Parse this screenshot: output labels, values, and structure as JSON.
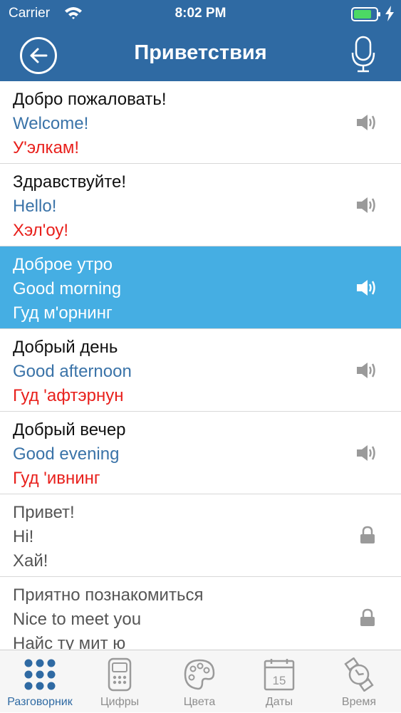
{
  "status_bar": {
    "carrier": "Carrier",
    "time": "8:02 PM"
  },
  "nav": {
    "title": "Приветствия"
  },
  "phrases": [
    {
      "native": "Добро пожаловать!",
      "english": "Welcome!",
      "transcription": "У'элкам!"
    },
    {
      "native": "Здравствуйте!",
      "english": "Hello!",
      "transcription": "Хэл'оу!"
    },
    {
      "native": "Доброе утро",
      "english": "Good morning",
      "transcription": "Гуд м'орнинг"
    },
    {
      "native": "Добрый день",
      "english": "Good afternoon",
      "transcription": "Гуд 'афтэрнун"
    },
    {
      "native": "Добрый вечер",
      "english": "Good evening",
      "transcription": "Гуд 'ивнинг"
    },
    {
      "native": "Привет!",
      "english": "Hi!",
      "transcription": "Хай!"
    },
    {
      "native": "Приятно познакомиться",
      "english": "Nice to meet you",
      "transcription": "Найс ту мит ю"
    }
  ],
  "tabs": [
    {
      "label": "Разговорник",
      "icon": "grid-dots-icon"
    },
    {
      "label": "Цифры",
      "icon": "calculator-icon"
    },
    {
      "label": "Цвета",
      "icon": "palette-icon"
    },
    {
      "label": "Даты",
      "icon": "calendar-icon",
      "day": "15"
    },
    {
      "label": "Время",
      "icon": "watch-icon"
    }
  ],
  "colors": {
    "header": "#2f6aa3",
    "selected_row": "#45aee3",
    "english_text": "#3a73a8",
    "transcription_text": "#e8201c"
  }
}
